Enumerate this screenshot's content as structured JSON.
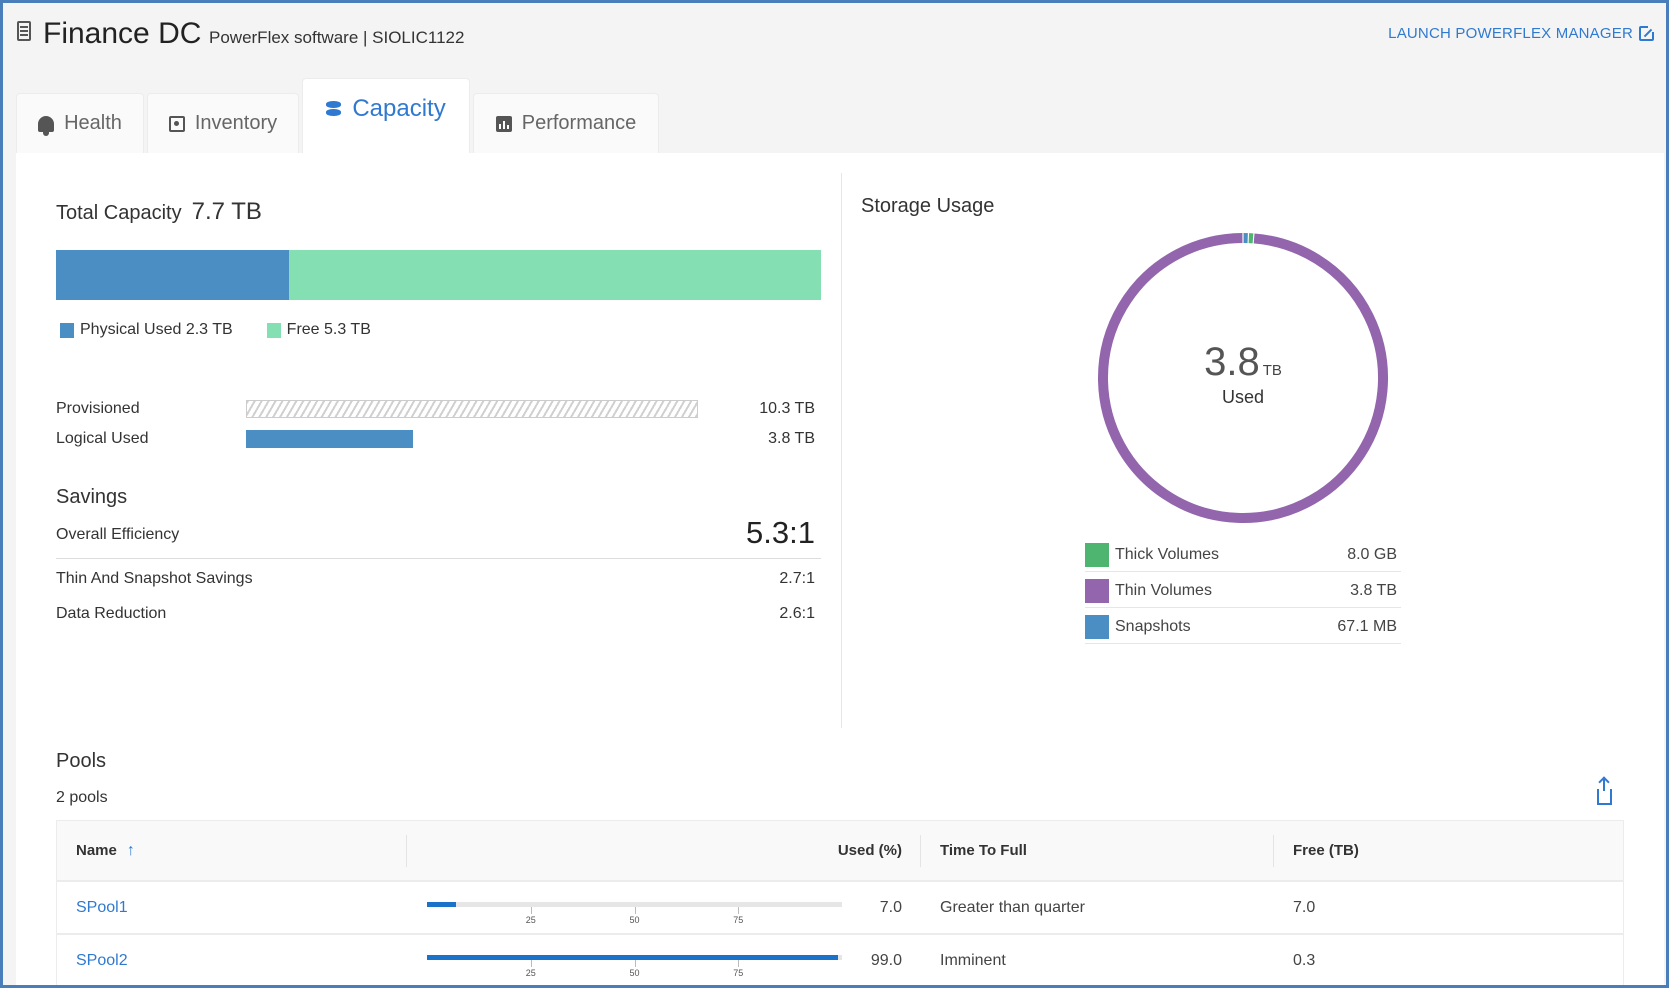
{
  "header": {
    "title": "Finance DC",
    "subtitle": "PowerFlex software | SIOLIC1122",
    "launch_label": "LAUNCH POWERFLEX MANAGER"
  },
  "tabs": [
    {
      "label": "Health",
      "icon": "bell-icon",
      "active": false
    },
    {
      "label": "Inventory",
      "icon": "inventory-icon",
      "active": false
    },
    {
      "label": "Capacity",
      "icon": "database-icon",
      "active": true
    },
    {
      "label": "Performance",
      "icon": "chart-icon",
      "active": false
    }
  ],
  "capacity": {
    "title": "Total Capacity",
    "total": "7.7 TB",
    "used_fraction": 0.305,
    "legend": {
      "used_label": "Physical Used 2.3 TB",
      "free_label": "Free 5.3 TB"
    },
    "colors": {
      "used": "#4a8ec4",
      "free": "#84e0b3"
    },
    "provisioned": {
      "label": "Provisioned",
      "value": "10.3 TB"
    },
    "logical_used": {
      "label": "Logical Used",
      "value": "3.8 TB",
      "fraction_of_provisioned": 0.369
    }
  },
  "savings": {
    "title": "Savings",
    "overall": {
      "label": "Overall Efficiency",
      "value": "5.3:1"
    },
    "rows": [
      {
        "label": "Thin And Snapshot Savings",
        "value": "2.7:1"
      },
      {
        "label": "Data Reduction",
        "value": "2.6:1"
      }
    ]
  },
  "storage_usage": {
    "title": "Storage Usage",
    "center_value": "3.8",
    "center_unit": "TB",
    "center_label": "Used",
    "items": [
      {
        "label": "Thick Volumes",
        "value": "8.0 GB",
        "color": "#4db56f",
        "fraction": 0.006
      },
      {
        "label": "Thin Volumes",
        "value": "3.8 TB",
        "color": "#9265ad",
        "fraction": 0.988
      },
      {
        "label": "Snapshots",
        "value": "67.1 MB",
        "color": "#4a8ec4",
        "fraction": 0.006
      }
    ]
  },
  "pools": {
    "title": "Pools",
    "count_label": "2 pools",
    "columns": [
      "Name",
      "Used (%)",
      "Time To Full",
      "Free (TB)"
    ],
    "tick_labels": [
      "25",
      "50",
      "75"
    ],
    "rows": [
      {
        "name": "SPool1",
        "used": "7.0",
        "used_pct": 7.0,
        "time_to_full": "Greater than quarter",
        "free": "7.0"
      },
      {
        "name": "SPool2",
        "used": "99.0",
        "used_pct": 99.0,
        "time_to_full": "Imminent",
        "free": "0.3"
      }
    ]
  }
}
